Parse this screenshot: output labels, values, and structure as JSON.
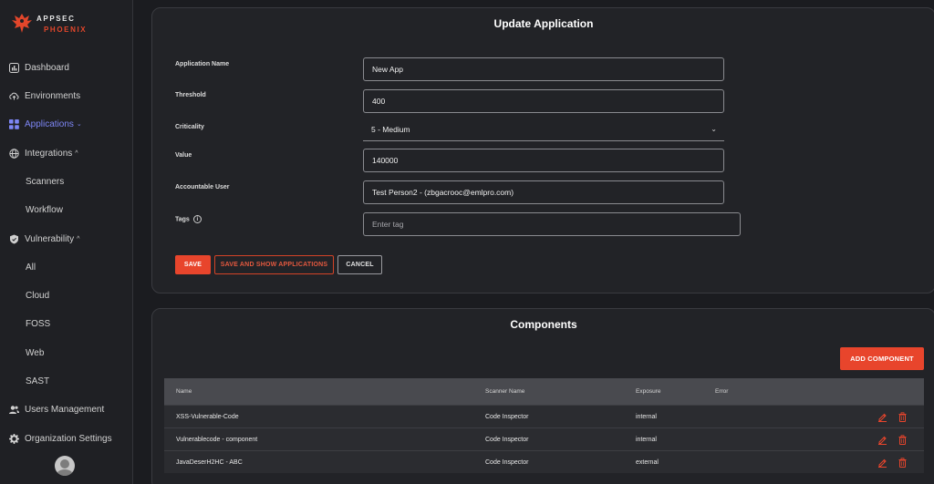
{
  "brand": {
    "line1": "APPSEC",
    "line2": "PHOENIX"
  },
  "sidebar": {
    "items": [
      {
        "label": "Dashboard",
        "icon": "chart-icon"
      },
      {
        "label": "Environments",
        "icon": "cloud-upload-icon"
      },
      {
        "label": "Applications",
        "icon": "grid-icon",
        "chevron": "⌄"
      },
      {
        "label": "Integrations",
        "icon": "globe-icon",
        "chevron": "^"
      },
      {
        "label": "Scanners"
      },
      {
        "label": "Workflow"
      },
      {
        "label": "Vulnerability",
        "icon": "shield-icon",
        "chevron": "^"
      },
      {
        "label": "All"
      },
      {
        "label": "Cloud"
      },
      {
        "label": "FOSS"
      },
      {
        "label": "Web"
      },
      {
        "label": "SAST"
      },
      {
        "label": "Users Management",
        "icon": "users-icon"
      },
      {
        "label": "Organization Settings",
        "icon": "gear-icon"
      }
    ]
  },
  "form": {
    "title": "Update Application",
    "application_name": {
      "label": "Application Name",
      "value": "New App"
    },
    "threshold": {
      "label": "Threshold",
      "value": "400"
    },
    "criticality": {
      "label": "Criticality",
      "value": "5 - Medium"
    },
    "value": {
      "label": "Value",
      "value": "140000"
    },
    "accountable_user": {
      "label": "Accountable User",
      "value": "Test Person2 - (zbgacrooc@emlpro.com)"
    },
    "tags": {
      "label": "Tags",
      "placeholder": "Enter tag",
      "info": "i"
    },
    "buttons": {
      "save": "SAVE",
      "save_and_show": "SAVE AND SHOW APPLICATIONS",
      "cancel": "CANCEL"
    }
  },
  "components": {
    "title": "Components",
    "add_button": "ADD COMPONENT",
    "columns": [
      "Name",
      "Scanner Name",
      "Exposure",
      "Error"
    ],
    "rows": [
      {
        "name": "XSS-Vulnerable-Code",
        "scanner": "Code Inspector",
        "exposure": "internal",
        "error": ""
      },
      {
        "name": "Vulnerablecode - component",
        "scanner": "Code Inspector",
        "exposure": "internal",
        "error": ""
      },
      {
        "name": "JavaDeserH2HC - ABC",
        "scanner": "Code Inspector",
        "exposure": "external",
        "error": ""
      }
    ]
  },
  "colors": {
    "accent": "#e8452c",
    "active_nav": "#7d86f5",
    "background": "#1b1c20",
    "card": "#222327"
  }
}
